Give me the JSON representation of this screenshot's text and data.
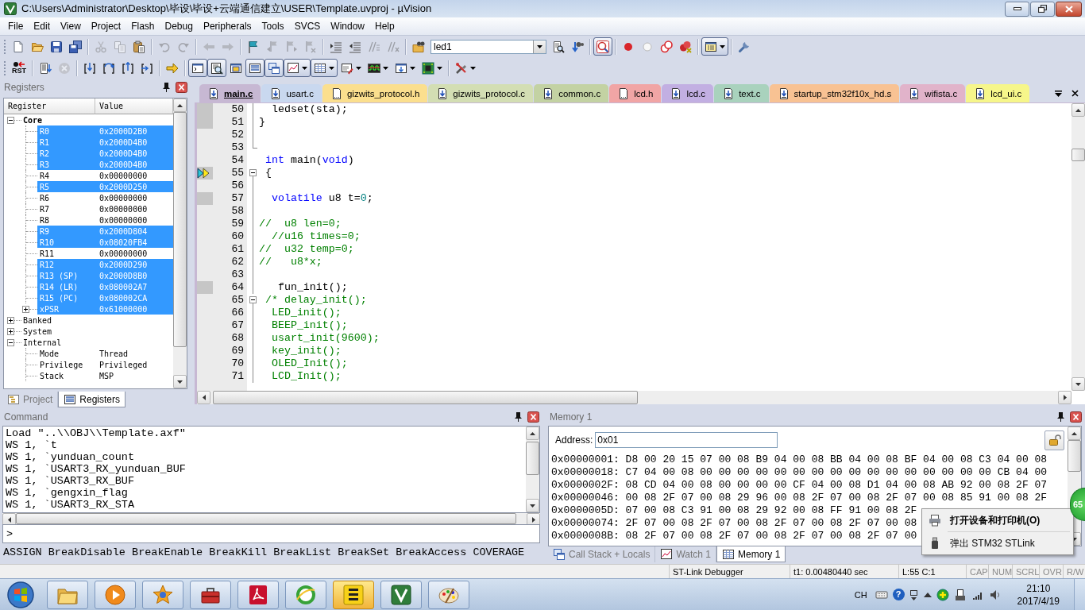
{
  "window": {
    "title": "C:\\Users\\Administrator\\Desktop\\毕设\\毕设+云端通信建立\\USER\\Template.uvproj - µVision"
  },
  "menu": [
    "File",
    "Edit",
    "View",
    "Project",
    "Flash",
    "Debug",
    "Peripherals",
    "Tools",
    "SVCS",
    "Window",
    "Help"
  ],
  "toolbars": [
    [
      [
        {
          "kind": "new",
          "disabled": false,
          "pressed": false,
          "dropdown": false
        },
        {
          "kind": "open",
          "disabled": false,
          "pressed": false,
          "dropdown": false
        },
        {
          "kind": "save",
          "disabled": false,
          "pressed": false,
          "dropdown": false
        },
        {
          "kind": "saveall",
          "disabled": false,
          "pressed": false,
          "dropdown": false
        }
      ],
      [
        {
          "kind": "cut",
          "disabled": true,
          "pressed": false,
          "dropdown": false
        },
        {
          "kind": "copy",
          "disabled": true,
          "pressed": false,
          "dropdown": false
        },
        {
          "kind": "paste",
          "disabled": false,
          "pressed": false,
          "dropdown": false
        }
      ],
      [
        {
          "kind": "undo",
          "disabled": true,
          "pressed": false,
          "dropdown": false
        },
        {
          "kind": "redo",
          "disabled": true,
          "pressed": false,
          "dropdown": false
        }
      ],
      [
        {
          "kind": "back",
          "disabled": true,
          "pressed": false,
          "dropdown": false
        },
        {
          "kind": "forward",
          "disabled": true,
          "pressed": false,
          "dropdown": false
        }
      ],
      [
        {
          "kind": "bookmark",
          "disabled": false,
          "pressed": false,
          "dropdown": false
        },
        {
          "kind": "bmprev",
          "disabled": true,
          "pressed": false,
          "dropdown": false
        },
        {
          "kind": "bmnext",
          "disabled": true,
          "pressed": false,
          "dropdown": false
        },
        {
          "kind": "bmclear",
          "disabled": true,
          "pressed": false,
          "dropdown": false
        }
      ],
      [
        {
          "kind": "indent",
          "disabled": false,
          "pressed": false,
          "dropdown": false
        },
        {
          "kind": "outdent",
          "disabled": false,
          "pressed": false,
          "dropdown": false
        },
        {
          "kind": "comment",
          "disabled": true,
          "pressed": false,
          "dropdown": false
        },
        {
          "kind": "uncomment",
          "disabled": true,
          "pressed": false,
          "dropdown": false
        }
      ],
      [
        {
          "kind": "findfiles",
          "disabled": false,
          "pressed": false,
          "dropdown": false
        },
        {
          "kind": "combo",
          "value": "led1",
          "disabled": false,
          "pressed": false,
          "dropdown": true
        },
        {
          "kind": "find",
          "disabled": false,
          "pressed": false,
          "dropdown": false
        },
        {
          "kind": "incfind",
          "disabled": false,
          "pressed": false,
          "dropdown": false
        }
      ],
      [
        {
          "kind": "debug",
          "disabled": false,
          "pressed": true,
          "dropdown": false
        }
      ],
      [
        {
          "kind": "bp",
          "disabled": false,
          "pressed": false,
          "dropdown": false
        },
        {
          "kind": "bptoggle",
          "disabled": false,
          "pressed": false,
          "dropdown": false
        },
        {
          "kind": "bpdisable",
          "disabled": false,
          "pressed": false,
          "dropdown": false
        },
        {
          "kind": "bpkill",
          "disabled": false,
          "pressed": false,
          "dropdown": false
        }
      ],
      [
        {
          "kind": "window",
          "disabled": false,
          "pressed": true,
          "dropdown": true
        }
      ],
      [
        {
          "kind": "config",
          "disabled": false,
          "pressed": false,
          "dropdown": false
        }
      ]
    ],
    [
      [
        {
          "kind": "reset",
          "label": "RST",
          "disabled": false,
          "pressed": false,
          "dropdown": false
        }
      ],
      [
        {
          "kind": "run",
          "disabled": false,
          "pressed": false,
          "dropdown": false
        },
        {
          "kind": "stop",
          "disabled": true,
          "pressed": false,
          "dropdown": false
        }
      ],
      [
        {
          "kind": "stepin",
          "disabled": false,
          "pressed": false,
          "dropdown": false
        },
        {
          "kind": "stepover",
          "disabled": false,
          "pressed": false,
          "dropdown": false
        },
        {
          "kind": "stepout",
          "disabled": false,
          "pressed": false,
          "dropdown": false
        },
        {
          "kind": "runtocursor",
          "disabled": false,
          "pressed": false,
          "dropdown": false
        }
      ],
      [
        {
          "kind": "nextstmt",
          "disabled": false,
          "pressed": false,
          "dropdown": false
        }
      ],
      [
        {
          "kind": "cmdwin",
          "disabled": false,
          "pressed": true,
          "dropdown": false
        },
        {
          "kind": "disasm",
          "disabled": false,
          "pressed": true,
          "dropdown": false
        },
        {
          "kind": "symbols",
          "disabled": false,
          "pressed": false,
          "dropdown": false
        },
        {
          "kind": "regwin",
          "disabled": false,
          "pressed": true,
          "dropdown": false
        },
        {
          "kind": "callstack",
          "disabled": false,
          "pressed": true,
          "dropdown": false
        },
        {
          "kind": "watch",
          "disabled": false,
          "pressed": true,
          "dropdown": true
        },
        {
          "kind": "memory",
          "disabled": false,
          "pressed": true,
          "dropdown": true
        },
        {
          "kind": "serial",
          "disabled": false,
          "pressed": false,
          "dropdown": true
        },
        {
          "kind": "analysis",
          "disabled": false,
          "pressed": false,
          "dropdown": true
        },
        {
          "kind": "trace",
          "disabled": false,
          "pressed": false,
          "dropdown": true
        },
        {
          "kind": "sysview",
          "disabled": false,
          "pressed": false,
          "dropdown": true
        }
      ],
      [
        {
          "kind": "toolbox",
          "disabled": false,
          "pressed": false,
          "dropdown": true
        }
      ]
    ]
  ],
  "registers": {
    "title": "Registers",
    "columns": [
      "Register",
      "Value"
    ],
    "tree": [
      {
        "name": "Core",
        "bold": true,
        "expanded": true,
        "children": [
          {
            "name": "R0",
            "value": "0x2000D2B0",
            "changed": true
          },
          {
            "name": "R1",
            "value": "0x2000D4B0",
            "changed": true
          },
          {
            "name": "R2",
            "value": "0x2000D4B0",
            "changed": true
          },
          {
            "name": "R3",
            "value": "0x2000D4B0",
            "changed": true
          },
          {
            "name": "R4",
            "value": "0x00000000",
            "changed": false
          },
          {
            "name": "R5",
            "value": "0x2000D250",
            "changed": true
          },
          {
            "name": "R6",
            "value": "0x00000000",
            "changed": false
          },
          {
            "name": "R7",
            "value": "0x00000000",
            "changed": false
          },
          {
            "name": "R8",
            "value": "0x00000000",
            "changed": false
          },
          {
            "name": "R9",
            "value": "0x2000D804",
            "changed": true
          },
          {
            "name": "R10",
            "value": "0x08020FB4",
            "changed": true
          },
          {
            "name": "R11",
            "value": "0x00000000",
            "changed": false
          },
          {
            "name": "R12",
            "value": "0x2000D290",
            "changed": true
          },
          {
            "name": "R13 (SP)",
            "value": "0x2000D8B0",
            "changed": true
          },
          {
            "name": "R14 (LR)",
            "value": "0x080002A7",
            "changed": true
          },
          {
            "name": "R15 (PC)",
            "value": "0x080002CA",
            "changed": true
          },
          {
            "name": "xPSR",
            "value": "0x61000000",
            "changed": true,
            "expanded": false
          }
        ]
      },
      {
        "name": "Banked",
        "bold": false,
        "expanded": false
      },
      {
        "name": "System",
        "bold": false,
        "expanded": false
      },
      {
        "name": "Internal",
        "bold": false,
        "expanded": true,
        "children": [
          {
            "name": "Mode",
            "value": "Thread",
            "changed": false
          },
          {
            "name": "Privilege",
            "value": "Privileged",
            "changed": false
          },
          {
            "name": "Stack",
            "value": "MSP",
            "changed": false
          }
        ]
      }
    ],
    "tabs": [
      {
        "label": "Project",
        "kind": "project",
        "selected": false
      },
      {
        "label": "Registers",
        "kind": "registers",
        "selected": true
      }
    ]
  },
  "editor": {
    "tabs": [
      {
        "label": "main.c",
        "kind": "source",
        "color": "#c7b8d3",
        "selected": true
      },
      {
        "label": "usart.c",
        "kind": "source",
        "color": "#c9d8ef",
        "selected": false
      },
      {
        "label": "gizwits_protocol.h",
        "kind": "header",
        "color": "#fbdf8e",
        "selected": false
      },
      {
        "label": "gizwits_protocol.c",
        "kind": "source",
        "color": "#d3deb3",
        "selected": false
      },
      {
        "label": "common.c",
        "kind": "source",
        "color": "#c3d2a3",
        "selected": false
      },
      {
        "label": "lcd.h",
        "kind": "header",
        "color": "#f1a5a5",
        "selected": false
      },
      {
        "label": "lcd.c",
        "kind": "source",
        "color": "#c2afe2",
        "selected": false
      },
      {
        "label": "text.c",
        "kind": "source",
        "color": "#a9d2bd",
        "selected": false
      },
      {
        "label": "startup_stm32f10x_hd.s",
        "kind": "source",
        "color": "#f8c293",
        "selected": false
      },
      {
        "label": "wifista.c",
        "kind": "source",
        "color": "#e1b3ca",
        "selected": false
      },
      {
        "label": "lcd_ui.c",
        "kind": "source",
        "color": "#f6f68a",
        "selected": false
      }
    ],
    "lines": [
      {
        "number": "50",
        "executable": true,
        "current": false,
        "kind": "fold_line",
        "segments": [
          {
            "kind": "plain",
            "text": "  ledset(sta);"
          }
        ]
      },
      {
        "number": "51",
        "executable": true,
        "current": false,
        "kind": "fold_line",
        "segments": [
          {
            "kind": "plain",
            "text": "}"
          }
        ]
      },
      {
        "number": "52",
        "executable": false,
        "current": false,
        "kind": "fold_line"
      },
      {
        "number": "53",
        "executable": false,
        "current": false,
        "kind": "fold_end"
      },
      {
        "number": "54",
        "executable": false,
        "current": false,
        "kind": "plain",
        "segments": [
          {
            "kind": "keyword",
            "text": " int"
          },
          {
            "kind": "plain",
            "text": " main("
          },
          {
            "kind": "keyword",
            "text": "void"
          },
          {
            "kind": "plain",
            "text": ")"
          }
        ]
      },
      {
        "number": "55",
        "executable": true,
        "current": true,
        "kind": "fold_start",
        "segments": [
          {
            "kind": "plain",
            "text": " {"
          }
        ]
      },
      {
        "number": "56",
        "executable": false,
        "current": false,
        "kind": "fold_line"
      },
      {
        "number": "57",
        "executable": true,
        "current": false,
        "kind": "fold_line",
        "segments": [
          {
            "kind": "keyword",
            "text": "  volatile"
          },
          {
            "kind": "plain",
            "text": " u8 t="
          },
          {
            "kind": "number",
            "text": "0"
          },
          {
            "kind": "plain",
            "text": ";"
          }
        ]
      },
      {
        "number": "58",
        "executable": false,
        "current": false,
        "kind": "fold_line"
      },
      {
        "number": "59",
        "executable": false,
        "current": false,
        "kind": "fold_line",
        "segments": [
          {
            "kind": "comment",
            "text": "//  u8 len=0;"
          }
        ]
      },
      {
        "number": "60",
        "executable": false,
        "current": false,
        "kind": "fold_line",
        "segments": [
          {
            "kind": "comment",
            "text": "  //u16 times=0;"
          }
        ]
      },
      {
        "number": "61",
        "executable": false,
        "current": false,
        "kind": "fold_line",
        "segments": [
          {
            "kind": "comment",
            "text": "//  u32 temp=0;"
          }
        ]
      },
      {
        "number": "62",
        "executable": false,
        "current": false,
        "kind": "fold_line",
        "segments": [
          {
            "kind": "comment",
            "text": "//   u8*x;"
          }
        ]
      },
      {
        "number": "63",
        "executable": false,
        "current": false,
        "kind": "fold_line"
      },
      {
        "number": "64",
        "executable": true,
        "current": false,
        "kind": "fold_line",
        "segments": [
          {
            "kind": "plain",
            "text": "   fun_init();"
          }
        ]
      },
      {
        "number": "65",
        "executable": false,
        "current": false,
        "kind": "fold_start",
        "segments": [
          {
            "kind": "comment",
            "text": " /* delay_init();"
          }
        ]
      },
      {
        "number": "66",
        "executable": false,
        "current": false,
        "kind": "fold_line",
        "segments": [
          {
            "kind": "comment",
            "text": "  LED_init();"
          }
        ]
      },
      {
        "number": "67",
        "executable": false,
        "current": false,
        "kind": "fold_line",
        "segments": [
          {
            "kind": "comment",
            "text": "  BEEP_init();"
          }
        ]
      },
      {
        "number": "68",
        "executable": false,
        "current": false,
        "kind": "fold_line",
        "segments": [
          {
            "kind": "comment",
            "text": "  usart_init(9600);"
          }
        ]
      },
      {
        "number": "69",
        "executable": false,
        "current": false,
        "kind": "fold_line",
        "segments": [
          {
            "kind": "comment",
            "text": "  key_init();"
          }
        ]
      },
      {
        "number": "70",
        "executable": false,
        "current": false,
        "kind": "fold_line",
        "segments": [
          {
            "kind": "comment",
            "text": "  OLED_Init();"
          }
        ]
      },
      {
        "number": "71",
        "executable": false,
        "current": false,
        "kind": "fold_line",
        "segments": [
          {
            "kind": "comment",
            "text": "  LCD_Init();"
          }
        ]
      }
    ]
  },
  "command": {
    "title": "Command",
    "output": [
      "Load \"..\\\\OBJ\\\\Template.axf\"",
      "WS 1, `t",
      "WS 1, `yunduan_count",
      "WS 1, `USART3_RX_yunduan_BUF",
      "WS 1, `USART3_RX_BUF",
      "WS 1, `gengxin_flag",
      "WS 1, `USART3_RX_STA"
    ],
    "prompt": ">",
    "help": "ASSIGN BreakDisable BreakEnable BreakKill BreakList BreakSet BreakAccess COVERAGE"
  },
  "memory": {
    "title": "Memory 1",
    "address_label": "Address:",
    "address": "0x01",
    "rows": [
      "0x00000001: D8 00 20 15 07 00 08 B9 04 00 08 BB 04 00 08 BF 04 00 08 C3 04 00 08",
      "0x00000018: C7 04 00 08 00 00 00 00 00 00 00 00 00 00 00 00 00 00 00 00 CB 04 00",
      "0x0000002F: 08 CD 04 00 08 00 00 00 00 CF 04 00 08 D1 04 00 08 AB 92 00 08 2F 07",
      "0x00000046: 00 08 2F 07 00 08 29 96 00 08 2F 07 00 08 2F 07 00 08 85 91 00 08 2F",
      "0x0000005D: 07 00 08 C3 91 00 08 29 92 00 08 FF 91 00 08 2F",
      "0x00000074: 2F 07 00 08 2F 07 00 08 2F 07 00 08 2F 07 00 08",
      "0x0000008B: 08 2F 07 00 08 2F 07 00 08 2F 07 00 08 2F 07 00"
    ],
    "tabs": [
      {
        "label": "Call Stack + Locals",
        "kind": "callstack",
        "selected": false
      },
      {
        "label": "Watch 1",
        "kind": "watch",
        "selected": false
      },
      {
        "label": "Memory 1",
        "kind": "memory",
        "selected": true
      }
    ]
  },
  "status_bar": {
    "items": [
      "ST-Link Debugger",
      "t1: 0.00480440 sec",
      "L:55 C:1"
    ],
    "indicators": [
      {
        "label": "CAP",
        "on": false
      },
      {
        "label": "NUM",
        "on": false
      },
      {
        "label": "SCRL",
        "on": false
      },
      {
        "label": "OVR",
        "on": false
      },
      {
        "label": "R/W",
        "on": false
      }
    ]
  },
  "taskbar": {
    "apps": [
      {
        "kind": "explorer",
        "highlighted": false
      },
      {
        "kind": "media",
        "highlighted": false
      },
      {
        "kind": "star",
        "highlighted": false
      },
      {
        "kind": "toolbox",
        "highlighted": false
      },
      {
        "kind": "pdf",
        "highlighted": false
      },
      {
        "kind": "browser",
        "highlighted": false
      },
      {
        "kind": "cloud",
        "highlighted": true
      },
      {
        "kind": "keil",
        "highlighted": false
      },
      {
        "kind": "paint",
        "highlighted": false
      }
    ],
    "tray": {
      "language": "CH",
      "help": "?",
      "time": "21:10",
      "date": "2017/4/19"
    }
  },
  "tray_menu": [
    {
      "label": "打开设备和打印机(O)",
      "kind": "printer",
      "default": true
    },
    {
      "label": "弹出 STM32 STLink",
      "kind": "usb",
      "default": false
    }
  ],
  "floating_ball": {
    "text": "65"
  }
}
